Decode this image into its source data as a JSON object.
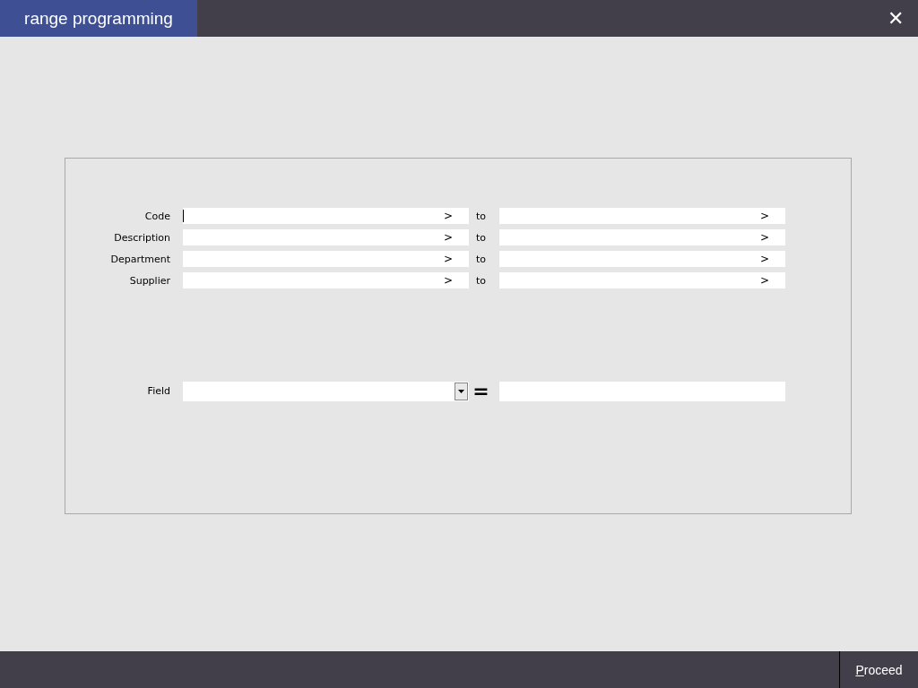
{
  "window": {
    "title": "range programming",
    "close": "✕"
  },
  "ranges": [
    {
      "label": "Code",
      "from_arrow": ">",
      "to": "to",
      "to_arrow": ">",
      "focused": true
    },
    {
      "label": "Description",
      "from_arrow": ">",
      "to": "to",
      "to_arrow": ">",
      "focused": false
    },
    {
      "label": "Department",
      "from_arrow": ">",
      "to": "to",
      "to_arrow": ">",
      "focused": false
    },
    {
      "label": "Supplier",
      "from_arrow": ">",
      "to": "to",
      "to_arrow": ">",
      "focused": false
    }
  ],
  "field": {
    "label": "Field",
    "equals": "="
  },
  "buttons": [
    {
      "label": "Proceed"
    }
  ]
}
